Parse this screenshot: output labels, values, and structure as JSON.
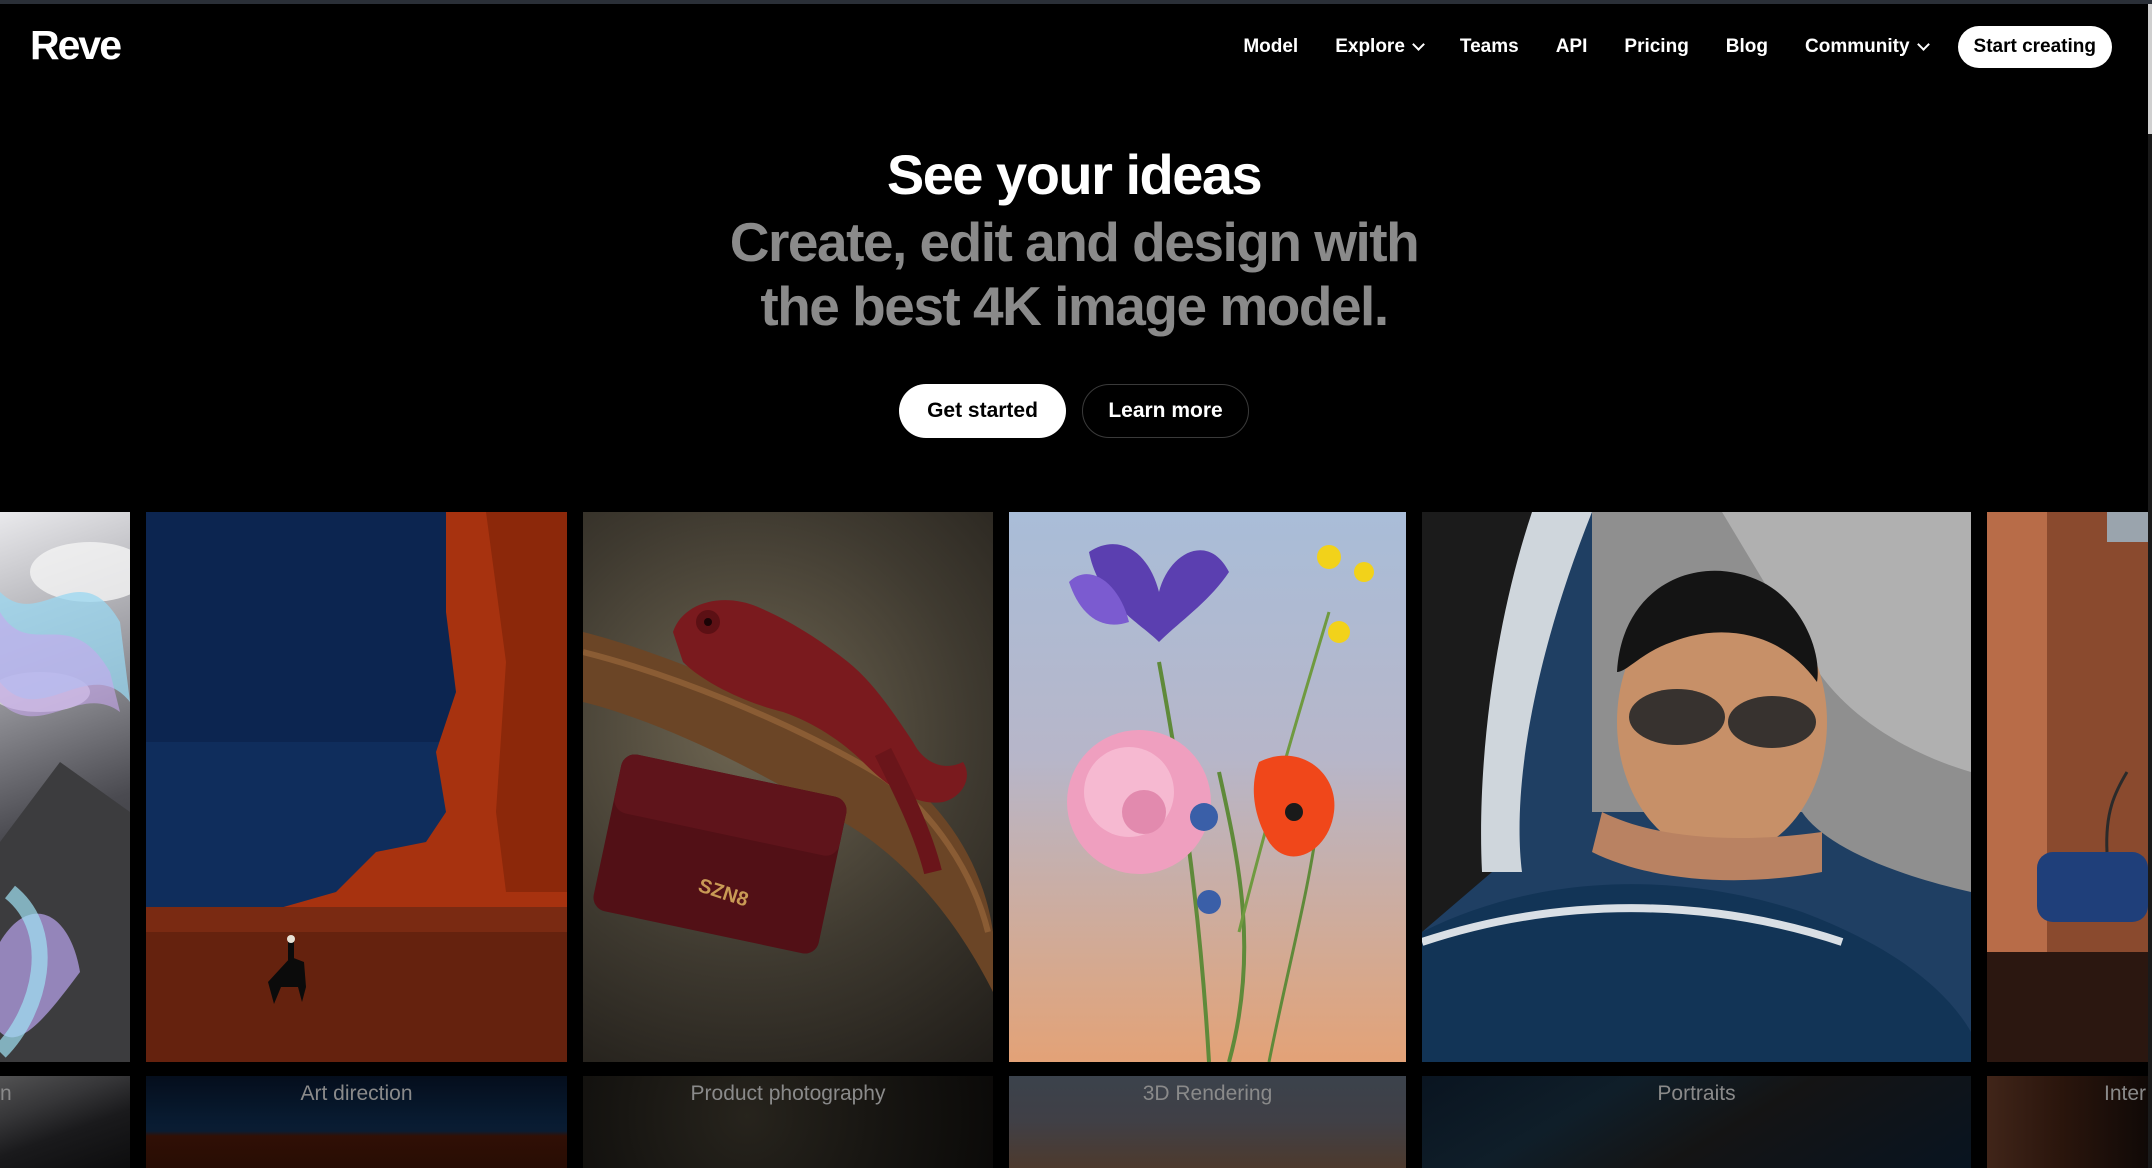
{
  "brand": {
    "logo_text": "Reve"
  },
  "nav": {
    "items": [
      {
        "label": "Model",
        "has_dropdown": false
      },
      {
        "label": "Explore",
        "has_dropdown": true
      },
      {
        "label": "Teams",
        "has_dropdown": false
      },
      {
        "label": "API",
        "has_dropdown": false
      },
      {
        "label": "Pricing",
        "has_dropdown": false
      },
      {
        "label": "Blog",
        "has_dropdown": false
      },
      {
        "label": "Community",
        "has_dropdown": true
      }
    ],
    "cta_label": "Start creating"
  },
  "hero": {
    "title": "See your ideas",
    "subtitle": "Create, edit and design with the best 4K image model.",
    "primary_button": "Get started",
    "secondary_button": "Learn more"
  },
  "gallery": {
    "cards": [
      {
        "caption": "n",
        "image": "abstract-swirl-over-mountains"
      },
      {
        "caption": "Art direction",
        "image": "rider-in-red-desert"
      },
      {
        "caption": "Product photography",
        "image": "chameleon-on-branch-with-bag",
        "bag_text": "SZN8"
      },
      {
        "caption": "3D Rendering",
        "image": "flower-bouquet"
      },
      {
        "caption": "Portraits",
        "image": "woman-with-sunglasses-in-car"
      },
      {
        "caption": "Inter",
        "image": "terracotta-interior"
      }
    ]
  },
  "colors": {
    "background": "#000000",
    "text": "#ffffff",
    "muted": "#8a8a8a"
  }
}
